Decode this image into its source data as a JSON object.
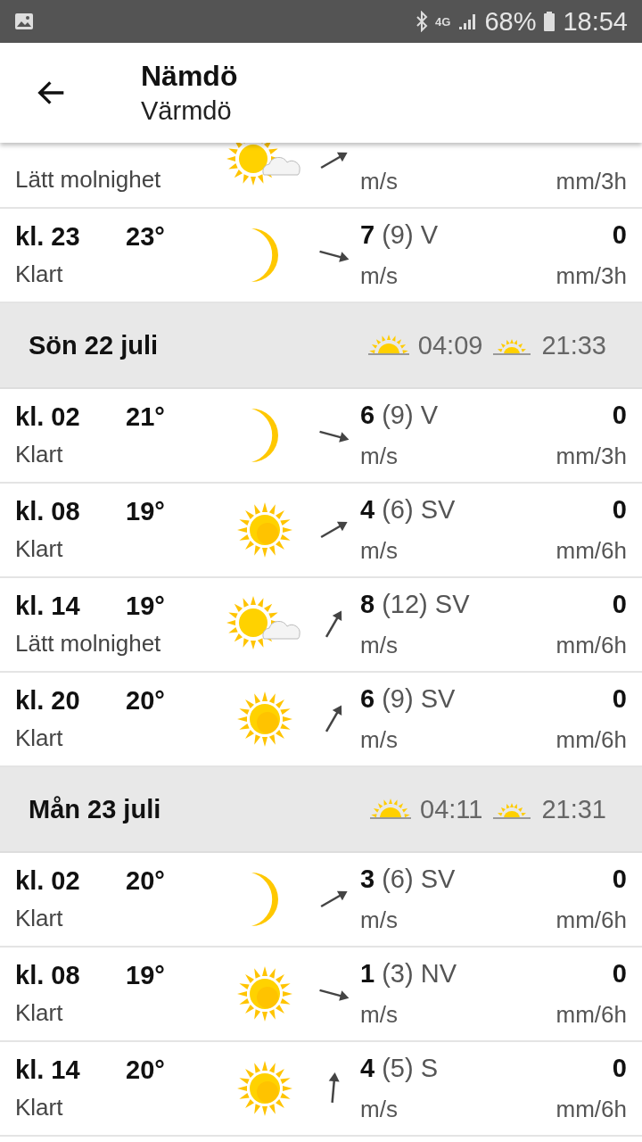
{
  "status_bar": {
    "network": "4G",
    "battery": "68%",
    "time": "18:54"
  },
  "header": {
    "title": "Nämdö",
    "subtitle": "Värmdö"
  },
  "list": [
    {
      "kind": "partly",
      "condition": "Lätt molnighet",
      "arrow": {
        "kind": "ne"
      },
      "wind_unit": "m/s",
      "precip_unit": "mm/3h"
    },
    {
      "kind": "night",
      "time": "kl. 23",
      "temp": "23°",
      "condition": "Klart",
      "arrow": {
        "kind": "ese"
      },
      "wind": "7",
      "gust": "(9)",
      "dir": "V",
      "wind_unit": "m/s",
      "precip": "0",
      "precip_unit": "mm/3h"
    },
    {
      "kind": "day",
      "label": "Sön 22 juli",
      "sunrise": "04:09",
      "sunset": "21:33"
    },
    {
      "kind": "night",
      "time": "kl. 02",
      "temp": "21°",
      "condition": "Klart",
      "arrow": {
        "kind": "ese"
      },
      "wind": "6",
      "gust": "(9)",
      "dir": "V",
      "wind_unit": "m/s",
      "precip": "0",
      "precip_unit": "mm/3h"
    },
    {
      "kind": "sunny",
      "time": "kl. 08",
      "temp": "19°",
      "condition": "Klart",
      "arrow": {
        "kind": "ne"
      },
      "wind": "4",
      "gust": "(6)",
      "dir": "SV",
      "wind_unit": "m/s",
      "precip": "0",
      "precip_unit": "mm/6h"
    },
    {
      "kind": "partly",
      "time": "kl. 14",
      "temp": "19°",
      "condition": "Lätt molnighet",
      "arrow": {
        "kind": "nne"
      },
      "wind": "8",
      "gust": "(12)",
      "dir": "SV",
      "wind_unit": "m/s",
      "precip": "0",
      "precip_unit": "mm/6h"
    },
    {
      "kind": "sunny",
      "time": "kl. 20",
      "temp": "20°",
      "condition": "Klart",
      "arrow": {
        "kind": "nne"
      },
      "wind": "6",
      "gust": "(9)",
      "dir": "SV",
      "wind_unit": "m/s",
      "precip": "0",
      "precip_unit": "mm/6h"
    },
    {
      "kind": "day",
      "label": "Mån 23 juli",
      "sunrise": "04:11",
      "sunset": "21:31"
    },
    {
      "kind": "night",
      "time": "kl. 02",
      "temp": "20°",
      "condition": "Klart",
      "arrow": {
        "kind": "ne"
      },
      "wind": "3",
      "gust": "(6)",
      "dir": "SV",
      "wind_unit": "m/s",
      "precip": "0",
      "precip_unit": "mm/6h"
    },
    {
      "kind": "sunny",
      "time": "kl. 08",
      "temp": "19°",
      "condition": "Klart",
      "arrow": {
        "kind": "ese"
      },
      "wind": "1",
      "gust": "(3)",
      "dir": "NV",
      "wind_unit": "m/s",
      "precip": "0",
      "precip_unit": "mm/6h"
    },
    {
      "kind": "sunny",
      "time": "kl. 14",
      "temp": "20°",
      "condition": "Klart",
      "arrow": {
        "kind": "n"
      },
      "wind": "4",
      "gust": "(5)",
      "dir": "S",
      "wind_unit": "m/s",
      "precip": "0",
      "precip_unit": "mm/6h"
    }
  ]
}
